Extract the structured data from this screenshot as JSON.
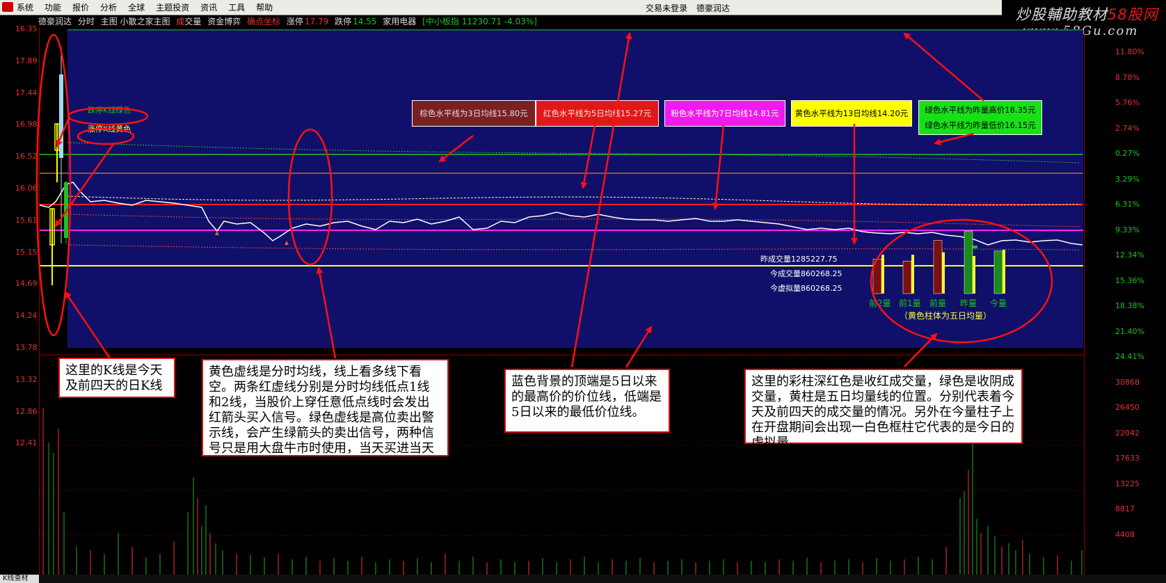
{
  "menubar": {
    "items": [
      "系统",
      "功能",
      "报价",
      "分析",
      "全球",
      "主题投资",
      "资讯",
      "工具",
      "帮助"
    ],
    "status": "交易未登录",
    "stock_name": "德豪润达"
  },
  "watermark": {
    "text_main": "炒股輔助教材",
    "text_red": "58股网",
    "url": "www.58Gu.com"
  },
  "infobar": {
    "stock": "德豪润达",
    "mode": "分时",
    "indicator": "主图 小散之家主图",
    "volume_label_a": "成",
    "volume_label_b": "交量",
    "fund": "资金博弈",
    "signal": "确点坐标",
    "limit_up_label": "涨停",
    "limit_up_value": "17.79",
    "limit_down_label": "跌停",
    "limit_down_value": "14.55",
    "sector": "家用电器",
    "index": "[中小板指 11230.71 -4.03%]"
  },
  "left_axis": [
    "16.35",
    "17.89",
    "17.44",
    "16.98",
    "16.52",
    "16.06",
    "15.61",
    "15.15",
    "14.69",
    "14.24",
    "13.78",
    "13.32",
    "12.86",
    "12.41"
  ],
  "right_axis": [
    {
      "v": "11.80%",
      "c": "r"
    },
    {
      "v": "8.78%",
      "c": "r"
    },
    {
      "v": "5.76%",
      "c": "r"
    },
    {
      "v": "2.74%",
      "c": "r"
    },
    {
      "v": "0.27%",
      "c": "g"
    },
    {
      "v": "3.29%",
      "c": "g"
    },
    {
      "v": "6.31%",
      "c": "g"
    },
    {
      "v": "9.33%",
      "c": "g"
    },
    {
      "v": "12.34%",
      "c": "g"
    },
    {
      "v": "15.36%",
      "c": "g"
    },
    {
      "v": "18.38%",
      "c": "g"
    },
    {
      "v": "21.40%",
      "c": "g"
    },
    {
      "v": "24.41%",
      "c": "g"
    },
    {
      "v": "30868",
      "c": "w"
    },
    {
      "v": "26450",
      "c": "w"
    },
    {
      "v": "22042",
      "c": "w"
    },
    {
      "v": "17633",
      "c": "w"
    },
    {
      "v": "13225",
      "c": "w"
    },
    {
      "v": "8817",
      "c": "w"
    },
    {
      "v": "4408",
      "c": "w"
    }
  ],
  "level_labels": {
    "brown": "棕色水平线为3日均线15.80元",
    "red": "红色水平线为5日均线15.27元",
    "pink": "粉色水平线为7日均线14.81元",
    "yellow": "黄色水平线为13日均线14.20元",
    "green_high": "绿色水平线为昨量高价18.35元",
    "green_low": "绿色水平线为昨量低价16.15元"
  },
  "kline_labels": {
    "down": "跌停K线绿色",
    "up": "涨停K线黄色"
  },
  "volume_panel": {
    "yesterday": "昨成交量1285227.75",
    "today": "今成交量860268.25",
    "virtual": "今虚拟量860268.25",
    "bars": [
      {
        "label": "前2量",
        "value": 0.55,
        "avg": 0.62,
        "color": "#7a1010"
      },
      {
        "label": "前1量",
        "value": 0.52,
        "avg": 0.62,
        "color": "#7a1010"
      },
      {
        "label": "前量",
        "value": 0.85,
        "avg": 0.66,
        "color": "#7a1010"
      },
      {
        "label": "昨量",
        "value": 1.0,
        "avg": 0.6,
        "color": "#1a8a1a"
      },
      {
        "label": "今量",
        "value": 0.68,
        "avg": 0.7,
        "color": "#1a8a1a"
      }
    ],
    "caption": "（黄色柱体为五日均量）"
  },
  "notes": {
    "kline": "这里的K线是今天及前四天的日K线",
    "avgline": "黄色虚线是分时均线，线上看多线下看空。两条红虚线分别是分时均线低点1线和2线，当股价上穿任意低点线时会发出红箭头买入信号。绿色虚线是高位卖出警示线，会产生绿箭头的卖出信号，两种信号只是用大盘牛市时使用，当天买进当天就有盈利。",
    "bluebg": "蓝色背景的顶端是5日以来的最高价的价位线，低端是5日以来的最低价位线。",
    "volume": "这里的彩柱深红色是收红成交量，绿色是收阴成交量，黄柱是五日均量线的位置。分别代表着今天及前四天的成交量的情况。另外在今量柱子上在开盘期间会出现一白色框柱它代表的是今日的虚拟量。"
  },
  "bottom": {
    "tab": "K线查材"
  }
}
